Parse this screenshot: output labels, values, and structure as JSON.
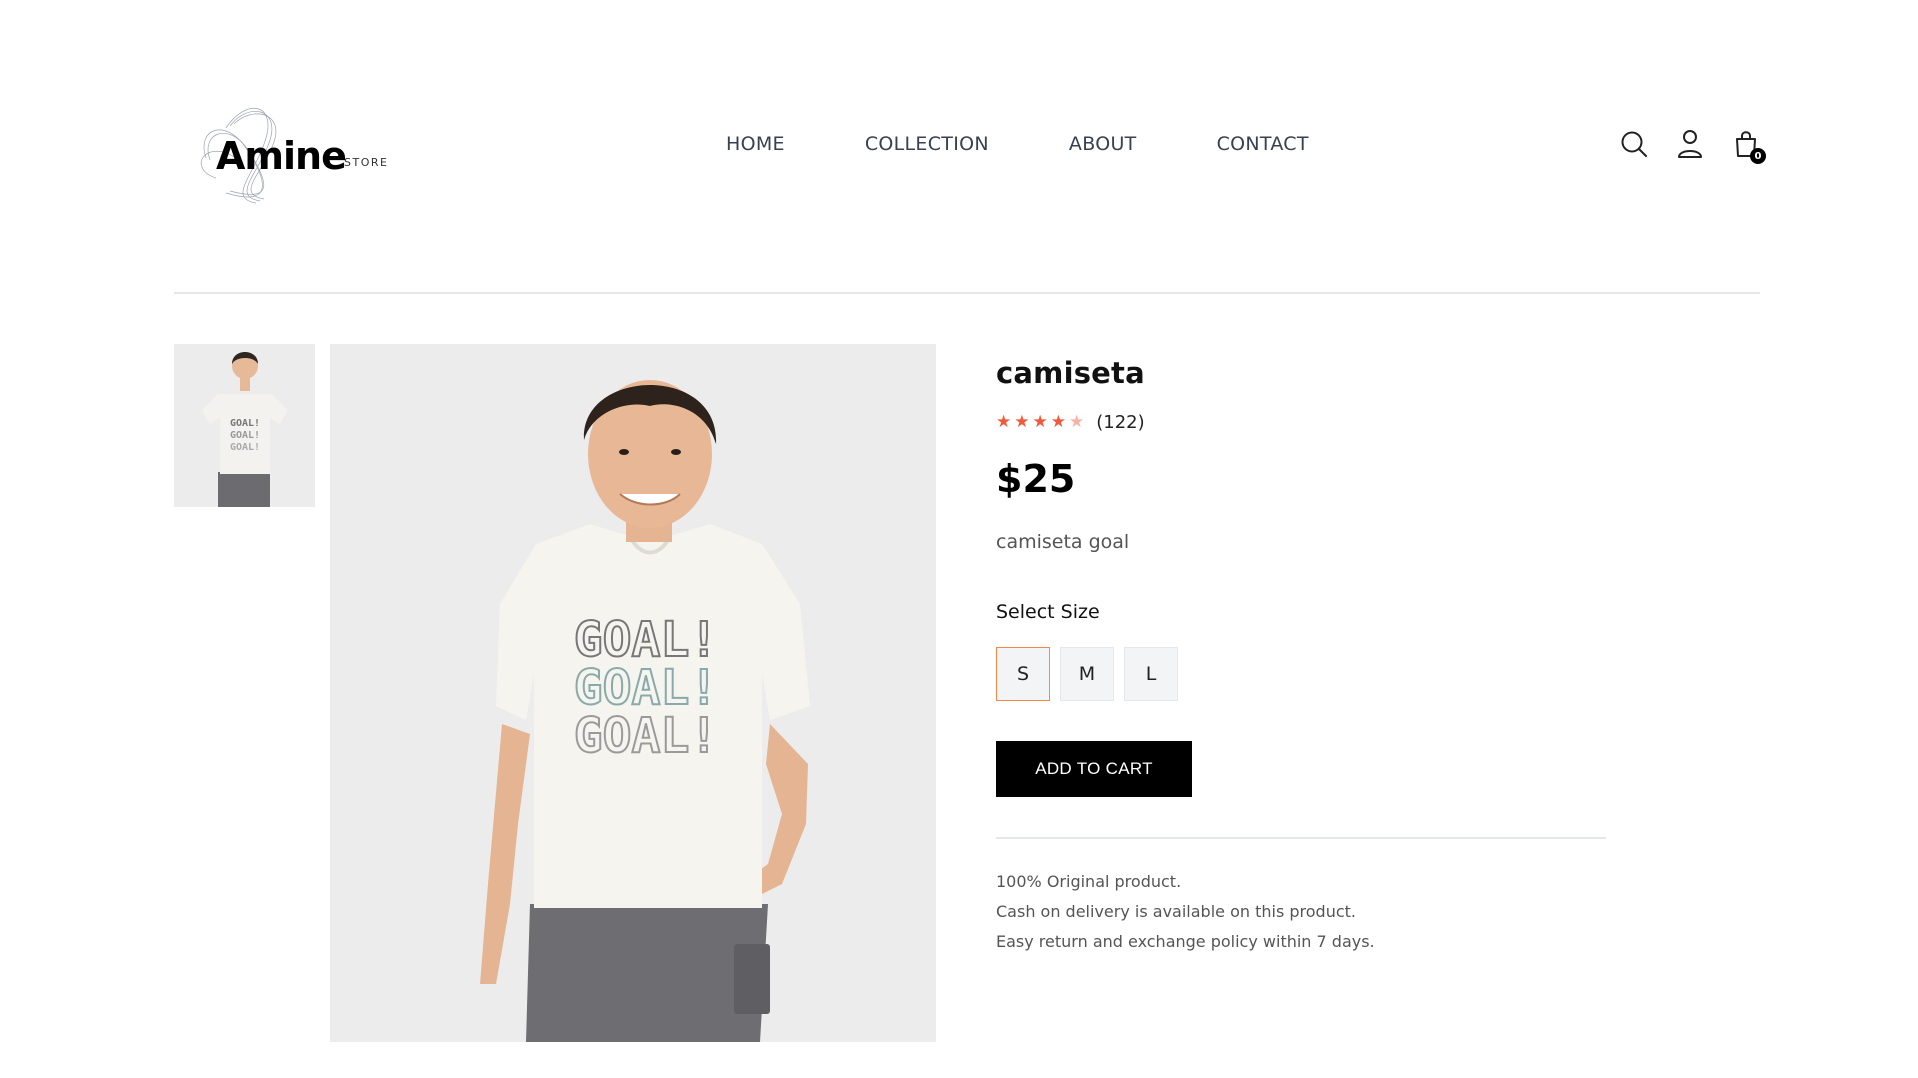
{
  "brand": {
    "name": "Amine",
    "tag": "STORE"
  },
  "nav": {
    "items": [
      "HOME",
      "COLLECTION",
      "ABOUT",
      "CONTACT"
    ]
  },
  "header_icons": {
    "search": "search-icon",
    "account": "user-icon",
    "cart": "shopping-bag-icon",
    "cart_count": "0"
  },
  "product": {
    "title": "camiseta",
    "rating": 4,
    "rating_max": 5,
    "reviews": "(122)",
    "price": "$25",
    "description": "camiseta goal",
    "select_size_label": "Select Size",
    "sizes": [
      "S",
      "M",
      "L"
    ],
    "selected_size": "S",
    "add_to_cart": "ADD TO CART",
    "policies": [
      "100% Original product.",
      "Cash on delivery is available on this product.",
      "Easy return and exchange policy within 7 days."
    ]
  },
  "colors": {
    "accent_star": "#f0593b",
    "selected_border": "#f08a4b",
    "button_bg": "#000000"
  }
}
